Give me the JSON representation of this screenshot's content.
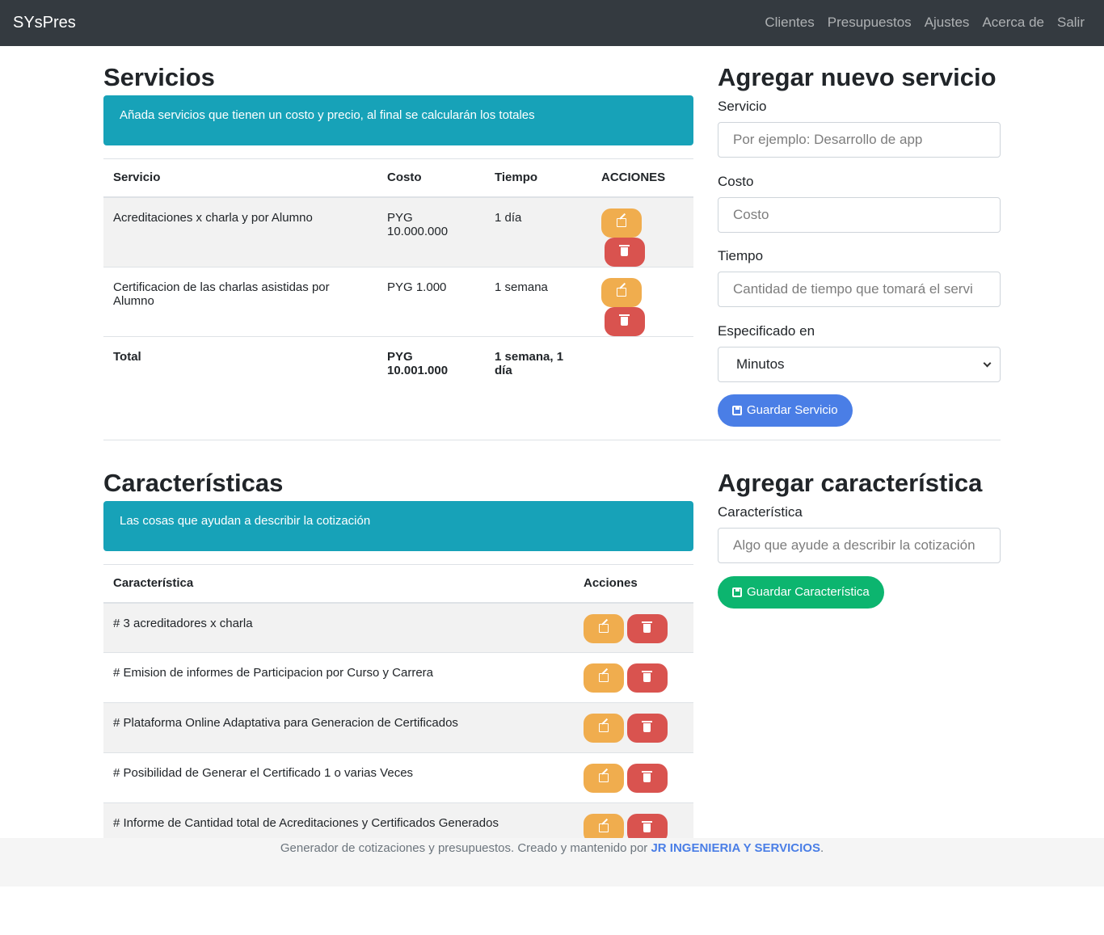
{
  "navbar": {
    "brand": "SYsPres",
    "links": [
      "Clientes",
      "Presupuestos",
      "Ajustes",
      "Acerca de",
      "Salir"
    ]
  },
  "services": {
    "title": "Servicios",
    "alert": "Añada servicios que tienen un costo y precio, al final se calcularán los totales",
    "headers": [
      "Servicio",
      "Costo",
      "Tiempo",
      "ACCIONES"
    ],
    "rows": [
      {
        "service": "Acreditaciones x charla y por Alumno",
        "cost": "PYG 10.000.000",
        "time": "1 día"
      },
      {
        "service": "Certificacion de las charlas asistidas por Alumno",
        "cost": "PYG 1.000",
        "time": "1 semana"
      }
    ],
    "total": {
      "label": "Total",
      "cost": "PYG 10.001.000",
      "time": "1 semana, 1 día"
    }
  },
  "add_service": {
    "title": "Agregar nuevo servicio",
    "service_label": "Servicio",
    "service_placeholder": "Por ejemplo: Desarrollo de app",
    "cost_label": "Costo",
    "cost_placeholder": "Costo",
    "time_label": "Tiempo",
    "time_placeholder": "Cantidad de tiempo que tomará el servi",
    "unit_label": "Especificado en",
    "unit_value": "Minutos",
    "save_label": "Guardar Servicio"
  },
  "features": {
    "title": "Características",
    "alert": "Las cosas que ayudan a describir la cotización",
    "headers": [
      "Característica",
      "Acciones"
    ],
    "rows": [
      "# 3 acreditadores x charla",
      "# Emision de informes de Participacion por Curso y Carrera",
      "# Plataforma Online Adaptativa para Generacion de Certificados",
      "# Posibilidad de Generar el Certificado 1 o varias Veces",
      "# Informe de Cantidad total de Acreditaciones y Certificados Generados"
    ]
  },
  "add_feature": {
    "title": "Agregar característica",
    "feature_label": "Característica",
    "feature_placeholder": "Algo que ayude a describir la cotización",
    "save_label": "Guardar Característica"
  },
  "footer": {
    "text": "Generador de cotizaciones y presupuestos. Creado y mantenido por ",
    "link": "JR INGENIERIA Y SERVICIOS",
    "end": "."
  },
  "colors": {
    "navbar": "#343a40",
    "info": "#17a2b8",
    "edit": "#f0ad4e",
    "delete": "#d9534f",
    "primary": "#4a7ee6",
    "success": "#0cb56f"
  }
}
